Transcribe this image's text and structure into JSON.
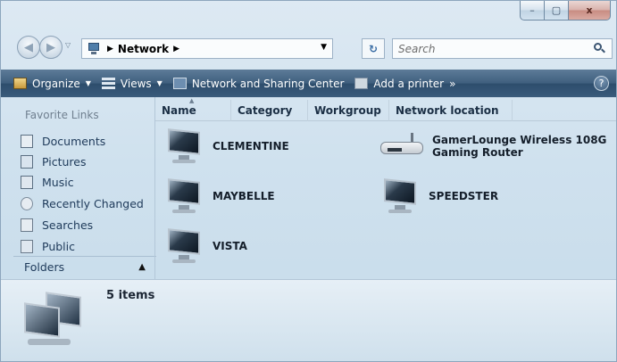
{
  "address": {
    "location": "Network",
    "search_placeholder": "Search"
  },
  "toolbar": {
    "organize": "Organize",
    "views": "Views",
    "network_sharing": "Network and Sharing Center",
    "add_printer": "Add a printer",
    "more": "»",
    "help": "?"
  },
  "nav_pane": {
    "title": "Favorite Links",
    "items": [
      "Documents",
      "Pictures",
      "Music",
      "Recently Changed",
      "Searches",
      "Public"
    ],
    "folders": "Folders"
  },
  "columns": [
    "Name",
    "Category",
    "Workgroup",
    "Network location"
  ],
  "devices": [
    {
      "name": "CLEMENTINE",
      "icon": "computer-icon"
    },
    {
      "name": "MAYBELLE",
      "icon": "computer-icon"
    },
    {
      "name": "VISTA",
      "icon": "computer-icon"
    },
    {
      "name": "GamerLounge Wireless 108G Gaming Router",
      "line1": "GamerLounge Wireless 108G",
      "line2": "Gaming Router",
      "icon": "router-icon"
    },
    {
      "name": "SPEEDSTER",
      "icon": "computer-icon"
    }
  ],
  "details": {
    "count": "5 items"
  },
  "window_controls": {
    "minimize": "–",
    "maximize": "▢",
    "close": "x"
  }
}
